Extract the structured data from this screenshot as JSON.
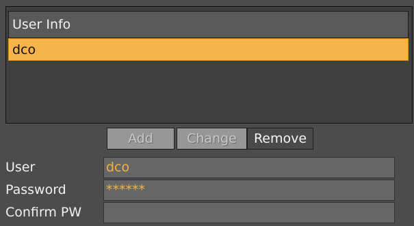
{
  "panel": {
    "title": "User Info",
    "items": [
      "dco"
    ]
  },
  "buttons": {
    "add": "Add",
    "change": "Change",
    "remove": "Remove"
  },
  "fields": {
    "user_label": "User",
    "user_value": "dco",
    "password_label": "Password",
    "password_value": "******",
    "confirm_label": "Confirm PW",
    "confirm_value": ""
  },
  "colors": {
    "background": "#4c4c4c",
    "selection": "#f7b34c",
    "accent_text": "#f2b24a"
  }
}
